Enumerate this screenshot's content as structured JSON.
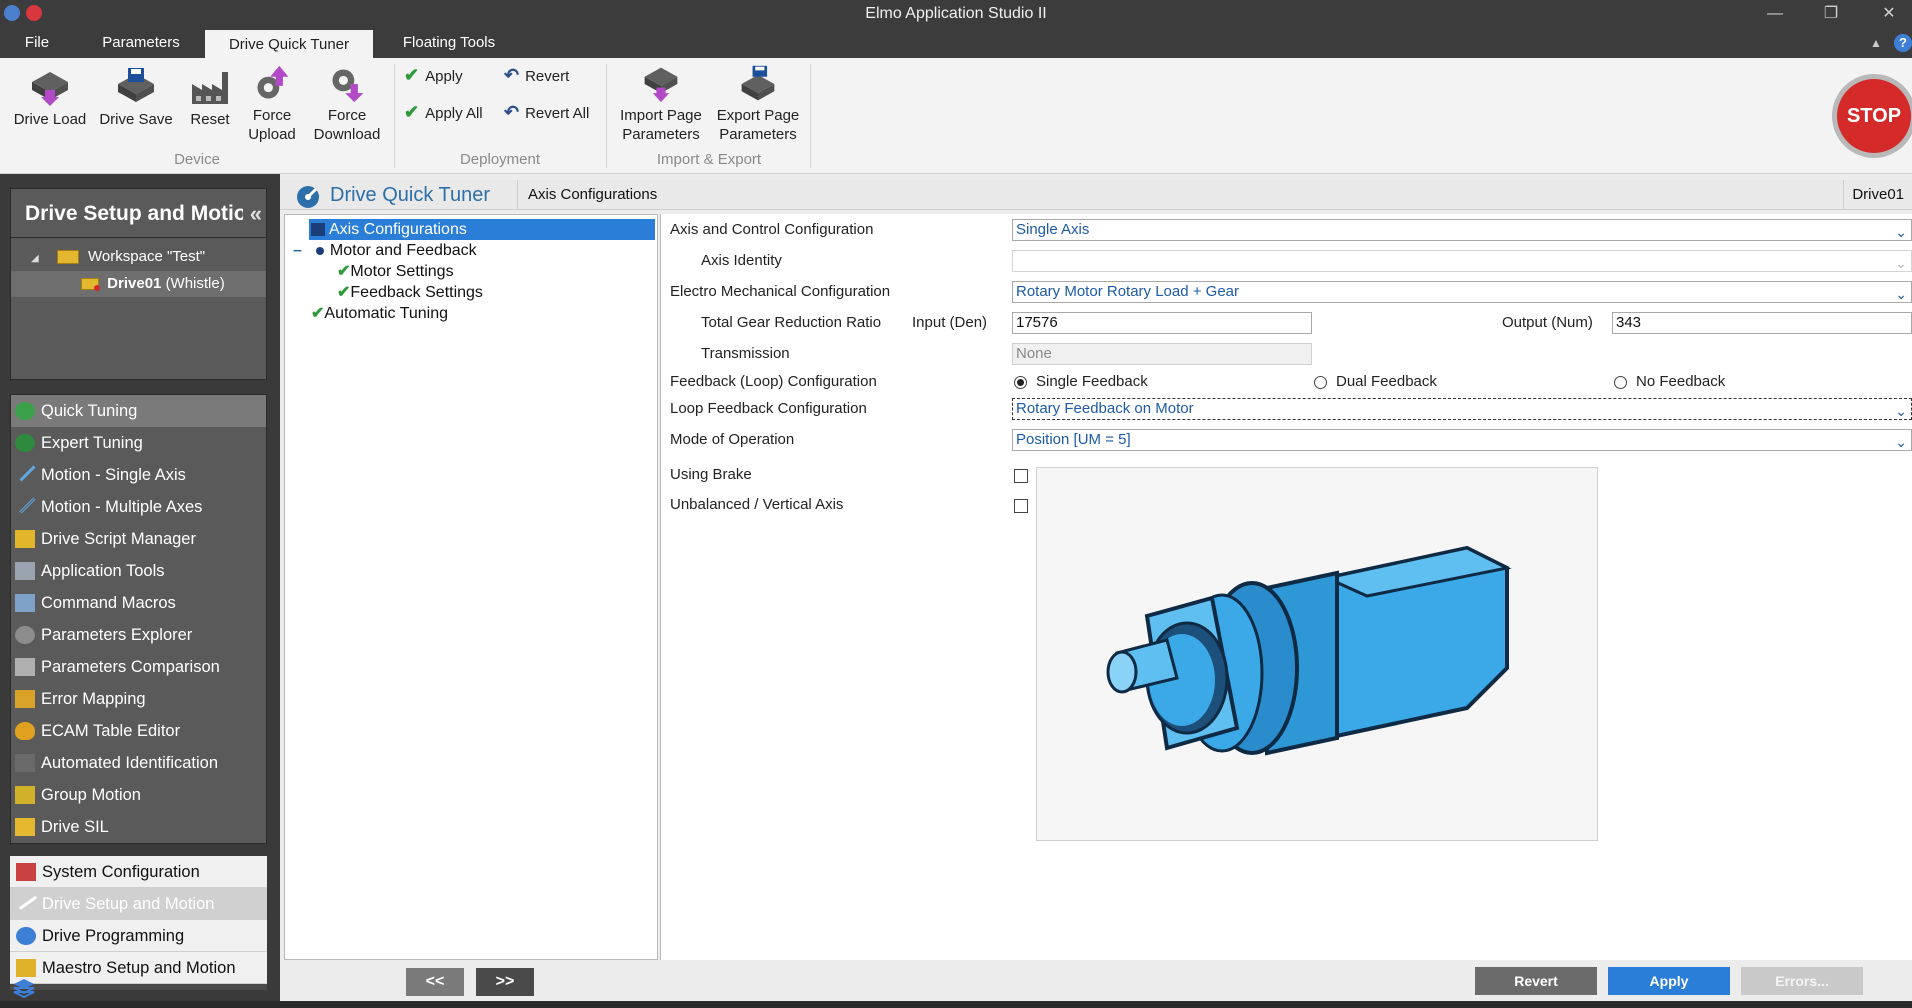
{
  "window": {
    "title": "Elmo Application Studio II"
  },
  "menu_tabs": [
    "File",
    "Parameters",
    "Drive Quick Tuner",
    "Floating Tools"
  ],
  "ribbon": {
    "device": {
      "group": "Device",
      "drive_load": "Drive Load",
      "drive_save": "Drive Save",
      "reset": "Reset",
      "force_upload": [
        "Force",
        "Upload"
      ],
      "force_download": [
        "Force",
        "Download"
      ]
    },
    "deployment": {
      "group": "Deployment",
      "apply": "Apply",
      "apply_all": "Apply All",
      "revert": "Revert",
      "revert_all": "Revert All"
    },
    "import_export": {
      "group": "Import & Export",
      "import": [
        "Import Page",
        "Parameters"
      ],
      "export": [
        "Export Page",
        "Parameters"
      ]
    },
    "stop": "STOP"
  },
  "left_panel": {
    "header": "Drive Setup and Motion",
    "workspace": "Workspace \"Test\"",
    "drive": "Drive01",
    "drive_suffix": "(Whistle)",
    "tools": [
      "Quick Tuning",
      "Expert Tuning",
      "Motion - Single Axis",
      "Motion - Multiple Axes",
      "Drive Script Manager",
      "Application Tools",
      "Command Macros",
      "Parameters Explorer",
      "Parameters Comparison",
      "Error Mapping",
      "ECAM Table Editor",
      "Automated Identification",
      "Group Motion",
      "Drive SIL"
    ],
    "nav": [
      "System Configuration",
      "Drive Setup and Motion",
      "Drive Programming",
      "Maestro Setup and Motion"
    ]
  },
  "breadcrumb": {
    "title": "Drive Quick Tuner",
    "page": "Axis Configurations",
    "drive": "Drive01"
  },
  "tree": {
    "axis_config": "Axis Configurations",
    "motor_feedback": "Motor and Feedback",
    "motor_settings": "Motor Settings",
    "feedback_settings": "Feedback Settings",
    "auto_tuning": "Automatic Tuning",
    "collapse_glyph": "–"
  },
  "form": {
    "axis_control_label": "Axis and Control Configuration",
    "axis_control_value": "Single Axis",
    "axis_identity_label": "Axis Identity",
    "axis_identity_value": "",
    "electro_label": "Electro Mechanical Configuration",
    "electro_value": "Rotary Motor Rotary Load + Gear",
    "gear_label": "Total Gear Reduction Ratio",
    "input_label": "Input (Den)",
    "input_value": "17576",
    "output_label": "Output (Num)",
    "output_value": "343",
    "transmission_label": "Transmission",
    "transmission_value": "None",
    "feedback_cfg_label": "Feedback (Loop) Configuration",
    "feedback_options": [
      "Single Feedback",
      "Dual Feedback",
      "No Feedback"
    ],
    "feedback_selected": "Single Feedback",
    "loop_fb_label": "Loop Feedback Configuration",
    "loop_fb_value": "Rotary Feedback on Motor",
    "mode_label": "Mode of Operation",
    "mode_value": "Position [UM = 5]",
    "brake_label": "Using Brake",
    "brake_checked": false,
    "unbalanced_label": "Unbalanced / Vertical Axis",
    "unbalanced_checked": false
  },
  "pager": {
    "prev": "<<",
    "next": ">>"
  },
  "actions": {
    "revert": "Revert",
    "apply": "Apply",
    "errors": "Errors..."
  },
  "colors": {
    "accent": "#2b7ed8",
    "stop": "#d42a2a",
    "motor": "#3ba8e8"
  }
}
